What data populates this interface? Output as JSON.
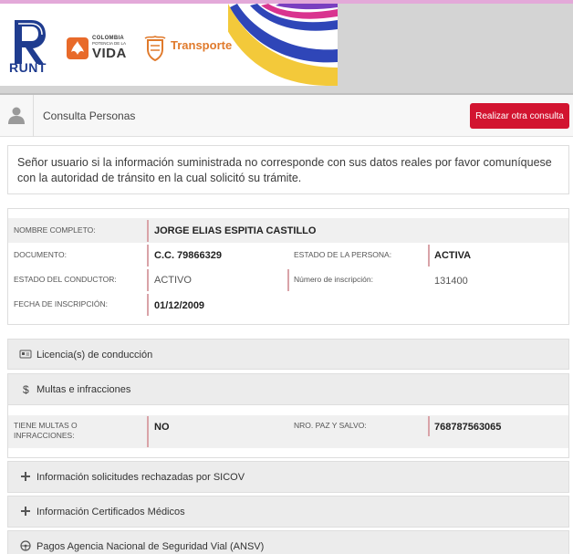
{
  "colors": {
    "accent_red": "#d21430",
    "label_bar": "#d9a3a8",
    "banner_grey": "#d4d4d4",
    "runt_blue": "#1f3c8f",
    "transporte_orange": "#e07a2c"
  },
  "banner": {
    "runt_logo_text": "RUNT",
    "colombia_line1": "COLOMBIA",
    "colombia_line2": "POTENCIA DE LA",
    "colombia_line3": "VIDA",
    "ministry_name": "Transporte"
  },
  "header": {
    "title": "Consulta Personas",
    "user_icon": "user-icon",
    "action_button": "Realizar otra consulta"
  },
  "notice": {
    "text": "Señor usuario si la información suministrada no corresponde con sus datos reales por favor comuníquese con la autoridad de tránsito en la cual solicitó su trámite."
  },
  "person": {
    "nombre_label": "NOMBRE COMPLETO:",
    "nombre_value": "JORGE ELIAS ESPITIA CASTILLO",
    "documento_label": "DOCUMENTO:",
    "documento_value": "C.C. 79866329",
    "estado_persona_label": "ESTADO DE LA PERSONA:",
    "estado_persona_value": "ACTIVA",
    "estado_conductor_label": "ESTADO DEL CONDUCTOR:",
    "estado_conductor_value": "ACTIVO",
    "inscripcion_num_label": "Número de inscripción:",
    "inscripcion_num_value": "131400",
    "fecha_inscripcion_label": "FECHA DE INSCRIPCIÓN:",
    "fecha_inscripcion_value": "01/12/2009"
  },
  "sections": {
    "licencias": {
      "label": "Licencia(s) de conducción",
      "icon": "license-card-icon"
    },
    "multas": {
      "label": "Multas e infracciones",
      "icon": "dollar-icon"
    },
    "sicov": {
      "label": "Información solicitudes rechazadas por SICOV",
      "icon": "plus-icon"
    },
    "certificados": {
      "label": "Información Certificados Médicos",
      "icon": "plus-icon"
    },
    "ansv": {
      "label": "Pagos Agencia Nacional de Seguridad Vial (ANSV)",
      "icon": "steering-wheel-icon"
    }
  },
  "multas": {
    "tiene_label_line1": "TIENE MULTAS O",
    "tiene_label_line2": "INFRACCIONES:",
    "tiene_value": "NO",
    "paz_salvo_label": "NRO. PAZ Y SALVO:",
    "paz_salvo_value": "768787563065"
  }
}
